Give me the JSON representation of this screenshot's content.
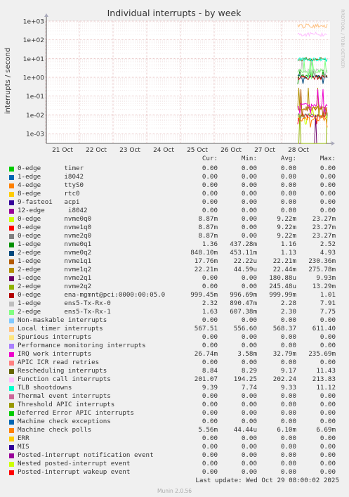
{
  "chart_data": {
    "type": "line",
    "title": "Individual interrupts - by week",
    "ylabel": "interrupts / second",
    "side_label": "RRDTOOL / TOBI OETIKER",
    "y_scale": "log",
    "ylim": [
      0.0003,
      1000
    ],
    "y_ticks": [
      "1e-03",
      "1e-02",
      "1e-01",
      "1e+00",
      "1e+01",
      "1e+02",
      "1e+03"
    ],
    "x_ticks": [
      "21 Oct",
      "22 Oct",
      "23 Oct",
      "24 Oct",
      "25 Oct",
      "26 Oct",
      "27 Oct",
      "28 Oct"
    ],
    "grid": true,
    "columns": [
      "Cur:",
      "Min:",
      "Avg:",
      "Max:"
    ],
    "series": [
      {
        "name": "0-edge      timer",
        "color": "#00cc00",
        "cur": "0.00",
        "min": "0.00",
        "avg": "0.00",
        "max": "0.00"
      },
      {
        "name": "1-edge      i8042",
        "color": "#0066b3",
        "cur": "0.00",
        "min": "0.00",
        "avg": "0.00",
        "max": "0.00"
      },
      {
        "name": "4-edge      ttyS0",
        "color": "#ff8000",
        "cur": "0.00",
        "min": "0.00",
        "avg": "0.00",
        "max": "0.00"
      },
      {
        "name": "8-edge      rtc0",
        "color": "#ffcc00",
        "cur": "0.00",
        "min": "0.00",
        "avg": "0.00",
        "max": "0.00"
      },
      {
        "name": "9-fasteoi   acpi",
        "color": "#330099",
        "cur": "0.00",
        "min": "0.00",
        "avg": "0.00",
        "max": "0.00"
      },
      {
        "name": "12-edge      i8042",
        "color": "#990099",
        "cur": "0.00",
        "min": "0.00",
        "avg": "0.00",
        "max": "0.00"
      },
      {
        "name": "0-edge      nvme0q0",
        "color": "#ccff00",
        "cur": "8.87m",
        "min": "0.00",
        "avg": "9.22m",
        "max": "23.27m"
      },
      {
        "name": "0-edge      nvme1q0",
        "color": "#ff0000",
        "cur": "8.87m",
        "min": "0.00",
        "avg": "9.22m",
        "max": "23.27m"
      },
      {
        "name": "0-edge      nvme2q0",
        "color": "#808080",
        "cur": "8.87m",
        "min": "0.00",
        "avg": "9.22m",
        "max": "23.27m"
      },
      {
        "name": "1-edge      nvme0q1",
        "color": "#008f00",
        "cur": "1.36",
        "min": "437.28m",
        "avg": "1.16",
        "max": "2.52"
      },
      {
        "name": "2-edge      nvme0q2",
        "color": "#00487d",
        "cur": "848.10m",
        "min": "453.11m",
        "avg": "1.13",
        "max": "4.93"
      },
      {
        "name": "1-edge      nvme1q1",
        "color": "#b35a00",
        "cur": "17.76m",
        "min": "22.22u",
        "avg": "22.21m",
        "max": "230.36m"
      },
      {
        "name": "2-edge      nvme1q2",
        "color": "#b38f00",
        "cur": "22.21m",
        "min": "44.59u",
        "avg": "22.44m",
        "max": "275.78m"
      },
      {
        "name": "1-edge      nvme2q1",
        "color": "#6b006b",
        "cur": "0.00",
        "min": "0.00",
        "avg": "180.88u",
        "max": "9.93m"
      },
      {
        "name": "2-edge      nvme2q2",
        "color": "#8fb300",
        "cur": "0.00",
        "min": "0.00",
        "avg": "245.48u",
        "max": "13.29m"
      },
      {
        "name": "0-edge      ena-mgmnt@pci:0000:00:05.0",
        "color": "#b30000",
        "cur": "999.45m",
        "min": "996.69m",
        "avg": "999.99m",
        "max": "1.01"
      },
      {
        "name": "1-edge      ens5-Tx-Rx-0",
        "color": "#bebebe",
        "cur": "2.32",
        "min": "890.47m",
        "avg": "2.28",
        "max": "7.91"
      },
      {
        "name": "2-edge      ens5-Tx-Rx-1",
        "color": "#80ff80",
        "cur": "1.63",
        "min": "607.38m",
        "avg": "2.30",
        "max": "7.75"
      },
      {
        "name": "Non-maskable interrupts",
        "color": "#80c9ff",
        "cur": "0.00",
        "min": "0.00",
        "avg": "0.00",
        "max": "0.00"
      },
      {
        "name": "Local timer interrupts",
        "color": "#ffc080",
        "cur": "567.51",
        "min": "556.60",
        "avg": "568.37",
        "max": "611.40"
      },
      {
        "name": "Spurious interrupts",
        "color": "#ffe680",
        "cur": "0.00",
        "min": "0.00",
        "avg": "0.00",
        "max": "0.00"
      },
      {
        "name": "Performance monitoring interrupts",
        "color": "#aa80ff",
        "cur": "0.00",
        "min": "0.00",
        "avg": "0.00",
        "max": "0.00"
      },
      {
        "name": "IRQ work interrupts",
        "color": "#ee00cc",
        "cur": "26.74m",
        "min": "3.58m",
        "avg": "32.79m",
        "max": "235.69m"
      },
      {
        "name": "APIC ICR read retries",
        "color": "#ff8080",
        "cur": "0.00",
        "min": "0.00",
        "avg": "0.00",
        "max": "0.00"
      },
      {
        "name": "Rescheduling interrupts",
        "color": "#666600",
        "cur": "8.84",
        "min": "8.29",
        "avg": "9.17",
        "max": "11.43"
      },
      {
        "name": "Function call interrupts",
        "color": "#ffbfff",
        "cur": "201.07",
        "min": "194.25",
        "avg": "202.24",
        "max": "213.83"
      },
      {
        "name": "TLB shootdowns",
        "color": "#00ffcc",
        "cur": "9.39",
        "min": "7.74",
        "avg": "9.33",
        "max": "11.12"
      },
      {
        "name": "Thermal event interrupts",
        "color": "#cc6699",
        "cur": "0.00",
        "min": "0.00",
        "avg": "0.00",
        "max": "0.00"
      },
      {
        "name": "Threshold APIC interrupts",
        "color": "#999900",
        "cur": "0.00",
        "min": "0.00",
        "avg": "0.00",
        "max": "0.00"
      },
      {
        "name": "Deferred Error APIC interrupts",
        "color": "#00cc00",
        "cur": "0.00",
        "min": "0.00",
        "avg": "0.00",
        "max": "0.00"
      },
      {
        "name": "Machine check exceptions",
        "color": "#0066b3",
        "cur": "0.00",
        "min": "0.00",
        "avg": "0.00",
        "max": "0.00"
      },
      {
        "name": "Machine check polls",
        "color": "#ff8000",
        "cur": "5.56m",
        "min": "44.44u",
        "avg": "6.10m",
        "max": "6.69m"
      },
      {
        "name": "ERR",
        "color": "#ffcc00",
        "cur": "0.00",
        "min": "0.00",
        "avg": "0.00",
        "max": "0.00"
      },
      {
        "name": "MIS",
        "color": "#330099",
        "cur": "0.00",
        "min": "0.00",
        "avg": "0.00",
        "max": "0.00"
      },
      {
        "name": "Posted-interrupt notification event",
        "color": "#990099",
        "cur": "0.00",
        "min": "0.00",
        "avg": "0.00",
        "max": "0.00"
      },
      {
        "name": "Nested posted-interrupt event",
        "color": "#ccff00",
        "cur": "0.00",
        "min": "0.00",
        "avg": "0.00",
        "max": "0.00"
      },
      {
        "name": "Posted-interrupt wakeup event",
        "color": "#ff0000",
        "cur": "0.00",
        "min": "0.00",
        "avg": "0.00",
        "max": "0.00"
      }
    ]
  },
  "footer": {
    "last_update": "Last update: Wed Oct 29 08:00:02 2025",
    "version": "Munin 2.0.56"
  }
}
